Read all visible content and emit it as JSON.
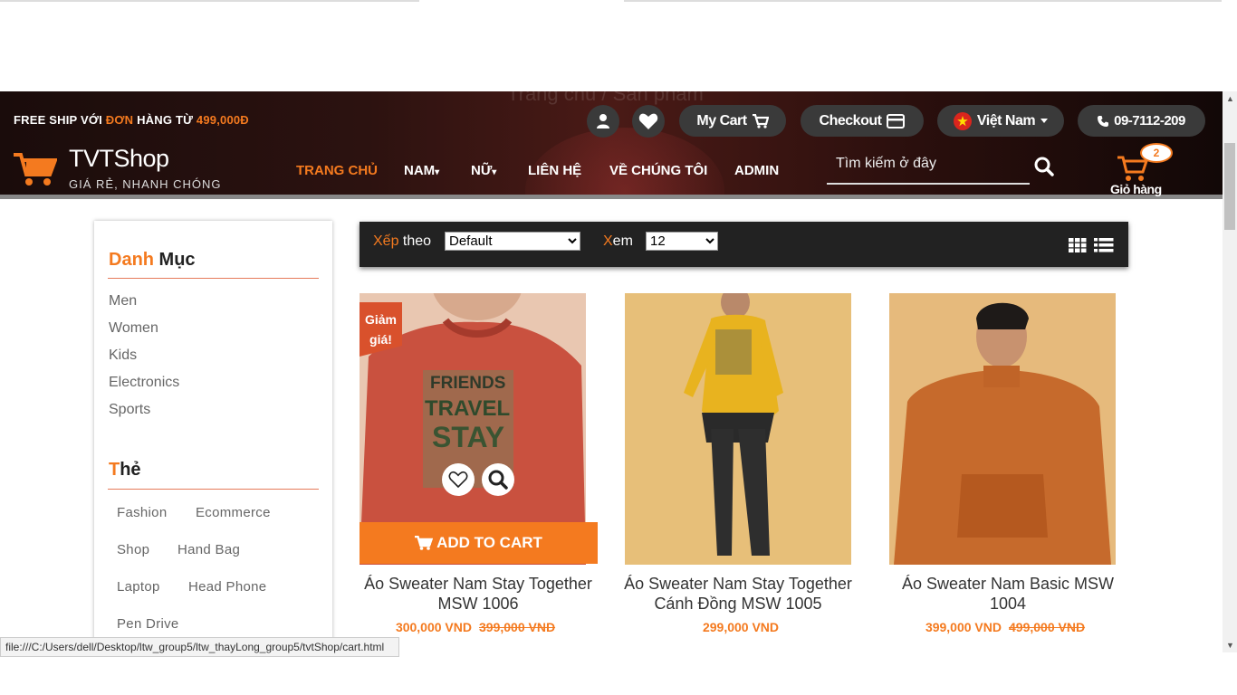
{
  "header": {
    "ghost_text": "Trang chủ / Sản phẩm",
    "freeship_prefix": "FREE SHIP VỚI ",
    "freeship_highlight1": "ĐƠN",
    "freeship_mid": " HÀNG TỪ ",
    "freeship_highlight2": "499,000Đ",
    "my_cart_label": "My Cart",
    "checkout_label": "Checkout",
    "language_label": "Việt Nam",
    "phone_label": "09-7112-209",
    "brand_tvt": "TVT",
    "brand_shop": "Shop",
    "tagline": "GIÁ RẺ, NHANH CHÓNG",
    "nav": [
      "TRANG CHỦ",
      "NAM",
      "NỮ",
      "LIÊN HỆ",
      "VỀ CHÚNG TÔI",
      "ADMIN"
    ],
    "search_placeholder": "Tìm kiếm ở đây",
    "cart_count": "2",
    "cart_label": "Giỏ hàng",
    "accent": "#f47a1f"
  },
  "sidebar": {
    "category_title_a": "Danh",
    "category_title_b": " Mục",
    "categories": [
      "Men",
      "Women",
      "Kids",
      "Electronics",
      "Sports"
    ],
    "tags_title_a": "T",
    "tags_title_b": "hẻ",
    "tags": [
      "Fashion",
      "Ecommerce",
      "Shop",
      "Hand Bag",
      "Laptop",
      "Head Phone",
      "Pen Drive"
    ]
  },
  "toolbar": {
    "sort_a": "Xếp",
    "sort_b": " theo",
    "sort_value": "Default",
    "view_a": "X",
    "view_b": "em",
    "view_value": "12"
  },
  "products": [
    {
      "title": "Áo Sweater Nam Stay Together MSW 1006",
      "price": "300,000 VND",
      "old_price": "399,000 VND",
      "sale_badge": "Giảm giá!",
      "add_to_cart": "ADD TO CART"
    },
    {
      "title": "Áo Sweater Nam Stay Together Cánh Đồng MSW 1005",
      "price": "299,000 VND",
      "old_price": ""
    },
    {
      "title": "Áo Sweater Nam Basic MSW 1004",
      "price": "399,000 VND",
      "old_price": "499,000 VND"
    }
  ],
  "statusbar": {
    "url": "file:///C:/Users/dell/Desktop/ltw_group5/ltw_thayLong_group5/tvtShop/cart.html"
  }
}
